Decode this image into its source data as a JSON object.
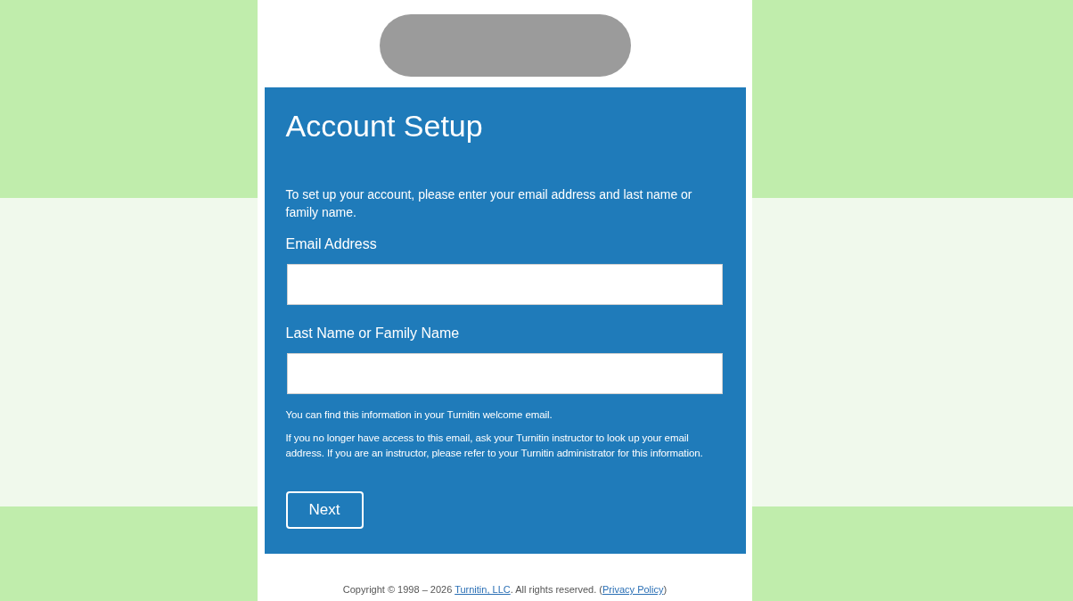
{
  "title": "Account Setup",
  "intro": "To set up your account, please enter your email address and last name or family name.",
  "fields": [
    {
      "label": "Email Address"
    },
    {
      "label": "Last Name or Family Name"
    }
  ],
  "help": [
    "You can find this information in your Turnitin welcome email.",
    "If you no longer have access to this email, ask your Turnitin instructor to look up your email address. If you are an instructor, please refer to your Turnitin administrator for this information."
  ],
  "button": "Next",
  "footer": {
    "before": "Copyright © 1998 – 2026 ",
    "company_link": "Turnitin, LLC",
    "middle": ". All rights reserved. (",
    "policy_link": "Privacy Policy",
    "after": ")"
  }
}
